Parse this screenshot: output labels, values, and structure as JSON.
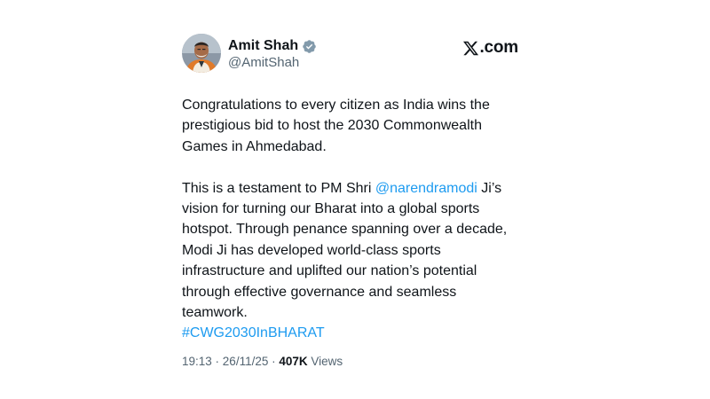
{
  "author": {
    "name": "Amit Shah",
    "handle": "@AmitShah",
    "verified_icon": "verified-badge-icon",
    "avatar_icon": "profile-photo"
  },
  "brand": {
    "label": "com",
    "dot": ".",
    "logo_icon": "x-logo-icon"
  },
  "tweet": {
    "para1": "Congratulations to every citizen as India wins the prestigious bid to host the 2030 Commonwealth Games in Ahmedabad.",
    "para2_before": "This is a testament to PM Shri ",
    "mention": "@narendramodi",
    "para2_after": " Ji’s vision for turning our Bharat into a global sports hotspot. Through penance spanning over a decade, Modi Ji has developed world-class sports infrastructure and uplifted our nation’s potential through effective governance and seamless teamwork.",
    "hashtag": "#CWG2030InBHARAT"
  },
  "meta": {
    "time": "19:13",
    "separator": " · ",
    "date": "26/11/25",
    "views_count": "407K",
    "views_label": "Views"
  },
  "colors": {
    "text": "#0f1419",
    "secondary": "#536471",
    "link": "#1d9bf0",
    "verified": "#829aab"
  }
}
